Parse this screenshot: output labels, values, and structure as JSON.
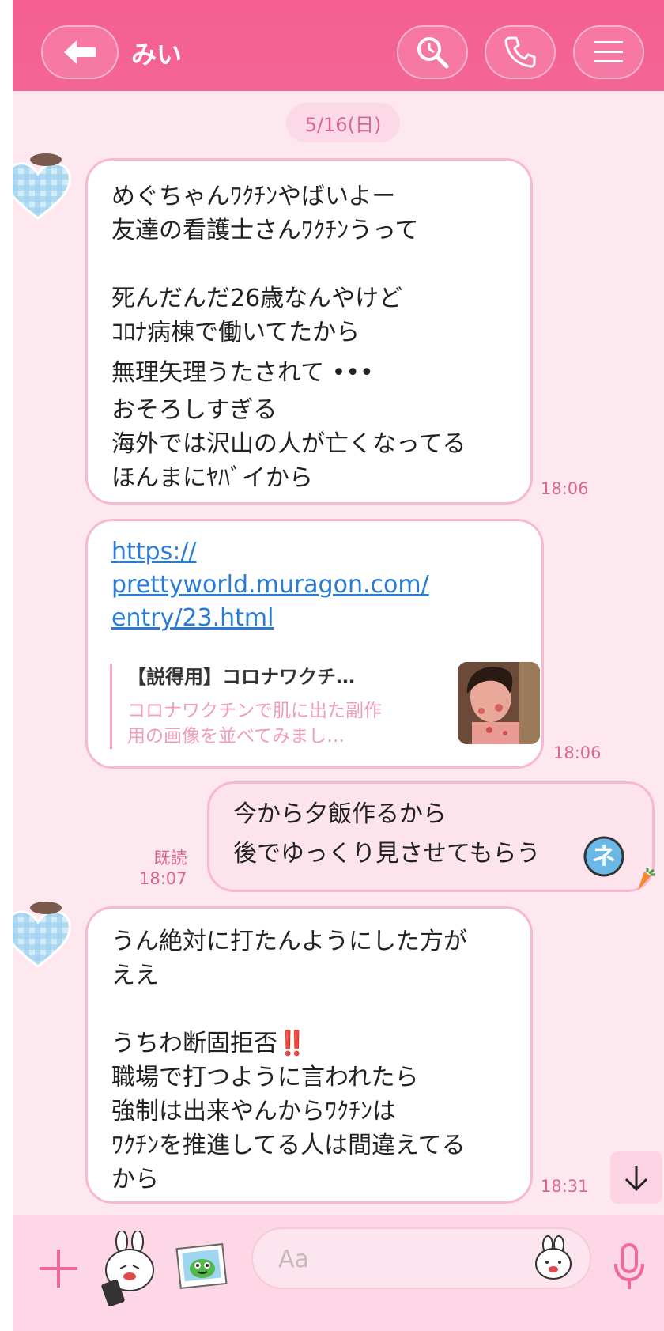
{
  "header": {
    "title": "みい"
  },
  "date_separator": "5/16(日)",
  "messages": [
    {
      "lines_a": [
        "めぐちゃんﾜｸﾁﾝやばいよー",
        "友達の看護士さんﾜｸﾁﾝうって"
      ],
      "lines_b": [
        "死んだんだ26歳なんやけど",
        "ｺﾛﾅ病棟で働いてたから",
        "無理矢理うたされて •••",
        "おそろしすぎる",
        "海外では沢山の人が亡くなってる",
        "ほんまにﾔﾊﾞイから"
      ],
      "time": "18:06"
    },
    {
      "link": "https://prettyworld.muragon.com/entry/23.html",
      "link_lines": [
        "https://",
        "prettyworld.muragon.com/",
        "entry/23.html"
      ],
      "preview_title": "【説得用】コロナワクチ…",
      "preview_desc": "コロナワクチンで肌に出た副作用の画像を並べてみまし…",
      "time": "18:06"
    },
    {
      "lines": [
        "今から夕飯作るから",
        "後でゆっくり見させてもらう"
      ],
      "read_label": "既読",
      "time": "18:07"
    },
    {
      "lines_a": [
        "うん絶対に打たんようにした方が",
        "ええ"
      ],
      "lines_b": [
        "うちわ断固拒否‼️",
        "職場で打つように言われたら",
        "強制は出来やんからﾜｸﾁﾝは",
        "ﾜｸﾁﾝを推進してる人は間違えてる",
        "から"
      ],
      "time": "18:31"
    }
  ],
  "input": {
    "placeholder": "Aa"
  },
  "colors": {
    "header": "#f55f93",
    "background": "#fde8f0",
    "accent": "#d9678f",
    "link": "#2a7bd6"
  },
  "icons": [
    "back-arrow-icon",
    "search-icon",
    "phone-icon",
    "menu-icon",
    "plus-icon",
    "sticker-icon",
    "image-icon",
    "emoji-icon",
    "mic-icon",
    "down-arrow-icon"
  ]
}
